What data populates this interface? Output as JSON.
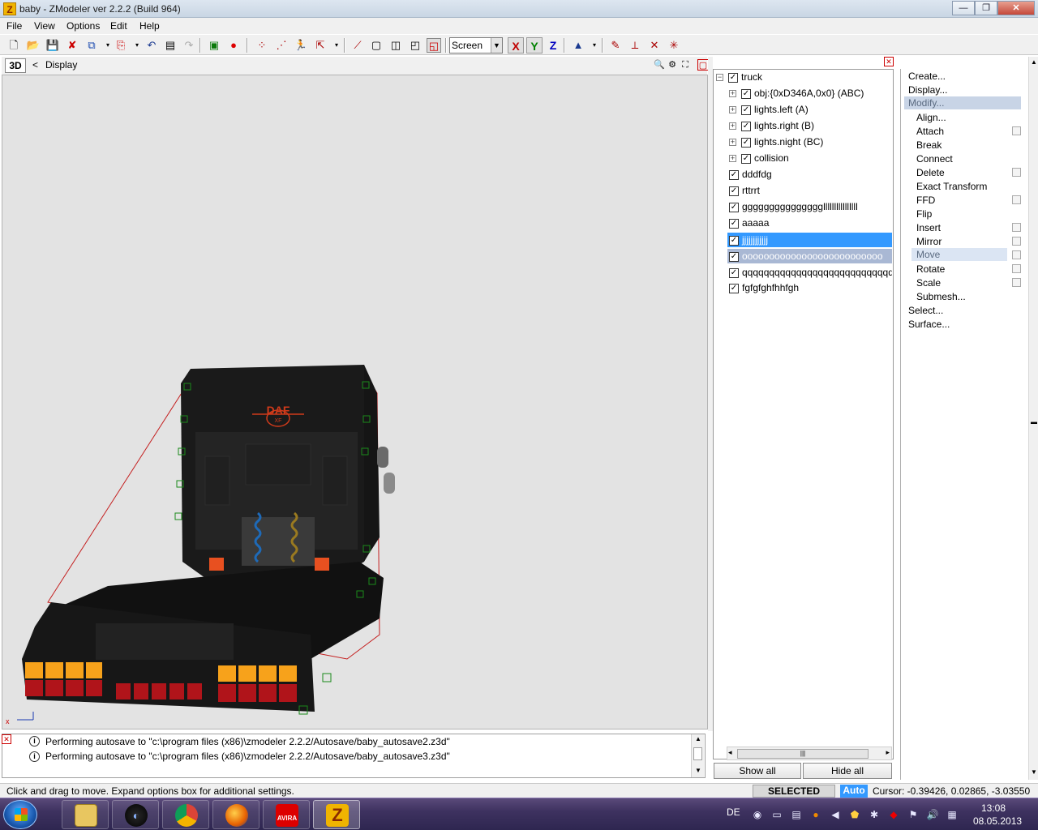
{
  "window": {
    "title": "baby - ZModeler ver 2.2.2 (Build 964)",
    "app_icon_letter": "Z",
    "min_glyph": "—",
    "max_glyph": "❐",
    "close_glyph": "✕"
  },
  "menu": [
    "File",
    "View",
    "Options",
    "Edit",
    "Help"
  ],
  "toolbar": {
    "coordinate_system": "Screen",
    "axis_x": "X",
    "axis_y": "Y",
    "axis_z": "Z",
    "axis_colors": {
      "x": "#c00000",
      "y": "#008000",
      "z": "#0000c0"
    }
  },
  "viewport": {
    "mode_button": "3D",
    "back_glyph": "<",
    "label": "Display",
    "background": "#e3e3e3",
    "truck_logo": "DAF",
    "truck_logo_sub": "XF",
    "lamp_colors": {
      "amber": "#f7a21b",
      "red": "#b0141a"
    }
  },
  "tree": {
    "close_glyph": "✕",
    "items": [
      {
        "label": "truck",
        "expander": "−",
        "check": "✓"
      },
      {
        "label": "obj:{0xD346A,0x0} (ABC)",
        "expander": "+",
        "check": "✓"
      },
      {
        "label": "lights.left (A)",
        "expander": "+",
        "check": "✓"
      },
      {
        "label": "lights.right (B)",
        "expander": "+",
        "check": "✓"
      },
      {
        "label": "lights.night (BC)",
        "expander": "+",
        "check": "✓"
      },
      {
        "label": "collision",
        "expander": "+",
        "check": "✓"
      },
      {
        "label": "dddfdg",
        "check": "✓"
      },
      {
        "label": "rttrrt",
        "check": "✓"
      },
      {
        "label": "gggggggggggggggllllllllllllllll",
        "check": "✓"
      },
      {
        "label": "aaaaa",
        "check": "✓"
      },
      {
        "label": "jjjjjjjjjjjj",
        "check": "✓"
      },
      {
        "label": "oooooooooooooooooooooooooo",
        "check": "✓"
      },
      {
        "label": "qqqqqqqqqqqqqqqqqqqqqqqqqqqqq",
        "check": "✓"
      },
      {
        "label": "fgfgfghfhhfgh",
        "check": "✓"
      }
    ],
    "show_all": "Show all",
    "hide_all": "Hide all",
    "scroll_left": "◂",
    "scroll_right": "▸",
    "scroll_grip": "|||"
  },
  "modifiers": {
    "top": [
      "Create...",
      "Display...",
      "Modify..."
    ],
    "sub": [
      "Align...",
      "Attach",
      "Break",
      "Connect",
      "Delete",
      "Exact Transform",
      "FFD",
      "Flip",
      "Insert",
      "Mirror",
      "Move",
      "Rotate",
      "Scale",
      "Submesh..."
    ],
    "bottom": [
      "Select...",
      "Surface..."
    ]
  },
  "log": {
    "close_glyph": "✕",
    "info_glyph": "i",
    "lines": [
      "Performing autosave to \"c:\\program files (x86)\\zmodeler 2.2.2/Autosave/baby_autosave2.z3d\"",
      "Performing autosave to \"c:\\program files (x86)\\zmodeler 2.2.2/Autosave/baby_autosave3.z3d\""
    ]
  },
  "status": {
    "hint": "Click and drag to move. Expand options box for additional settings.",
    "mode": "SELECTED MODE",
    "auto": "Auto",
    "cursor": "Cursor: -0.39426, 0.02865, -3.03550"
  },
  "taskbar": {
    "apps": [
      "explorer",
      "media-center",
      "chrome",
      "firefox",
      "avira",
      "zmodeler"
    ],
    "avira_label": "AVIRA",
    "zmodeler_label": "Z",
    "language": "DE",
    "time": "13:08",
    "date": "08.05.2013"
  }
}
